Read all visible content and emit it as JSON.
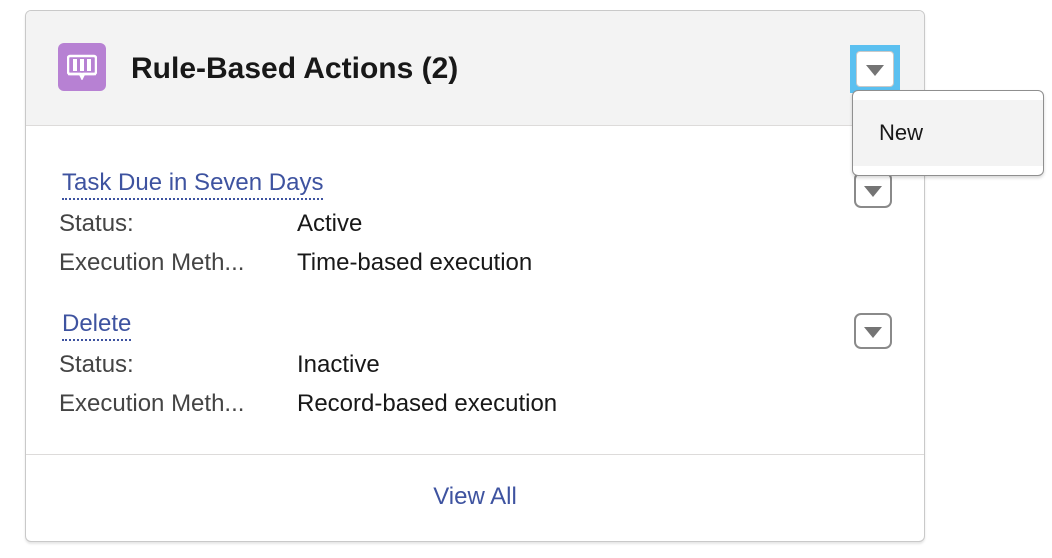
{
  "card": {
    "title": "Rule-Based Actions (2)",
    "icon": "book-icon",
    "icon_color": "#b781d3",
    "view_all_label": "View All"
  },
  "records": [
    {
      "name": "Task Due in Seven Days",
      "fields": [
        {
          "label": "Status:",
          "value": "Active"
        },
        {
          "label": "Execution Meth...",
          "value": "Time-based execution"
        }
      ]
    },
    {
      "name": "Delete",
      "fields": [
        {
          "label": "Status:",
          "value": "Inactive"
        },
        {
          "label": "Execution Meth...",
          "value": "Record-based execution"
        }
      ]
    }
  ],
  "dropdown": {
    "items": [
      {
        "label": "New"
      }
    ]
  },
  "colors": {
    "link": "#3e53a0",
    "focus_ring": "#5bc0f0",
    "header_bg": "#f3f3f3"
  }
}
